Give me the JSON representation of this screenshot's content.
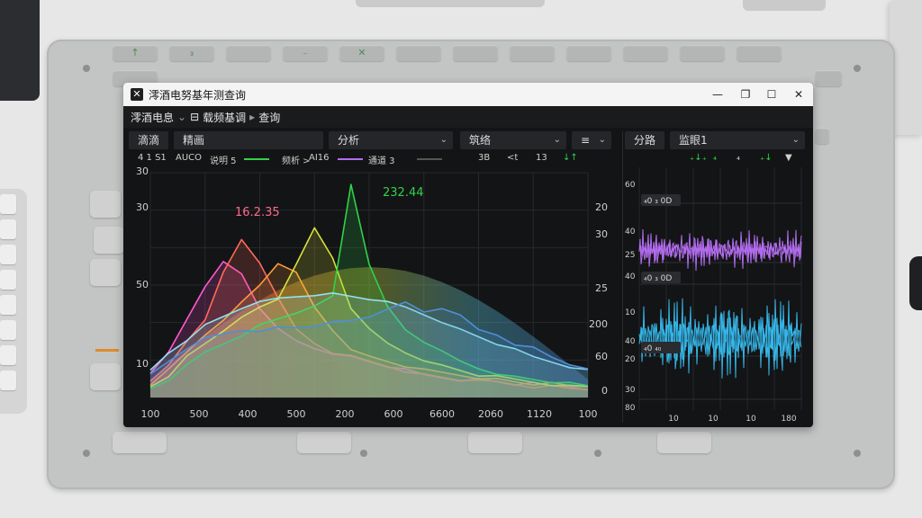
{
  "window": {
    "title": "澪酒电努基年测查询",
    "controls": {
      "minimize": "—",
      "maximize": "❐",
      "restore": "☐",
      "close": "✕"
    }
  },
  "menubar": {
    "item1": "澪酒电息",
    "chevron": "⌄",
    "icon": "⊟",
    "item2": "载频基调",
    "arrow": "▸",
    "item3": "查询"
  },
  "toolbar": {
    "box1": "滴滴",
    "box2": "精画",
    "box3": "分析",
    "box4": "筑络",
    "box5": "≡",
    "dropdown_arrow": "⌄",
    "right_box1": "分路",
    "right_box2": "监眼1",
    "icon": "⏆"
  },
  "legend": {
    "a": "4 1 S1",
    "b": "AUCO",
    "c": "说明 5",
    "d": "频析 >",
    "e": "AI16",
    "f": "通道 3",
    "g": "3B",
    "h": "<t",
    "i": "13",
    "j": "↓↑"
  },
  "right_legend": {
    "a": "₊↓₊",
    "b": "₄",
    "c": "₄",
    "d": "₊↓",
    "e": "▼"
  },
  "chart_data": {
    "type": "area",
    "x_ticks": [
      "100",
      "500",
      "400",
      "500",
      "200",
      "600",
      "6600",
      "2060",
      "1120",
      "100"
    ],
    "y_left_ticks": [
      "30",
      "30",
      "50",
      "10"
    ],
    "y_right_ticks": [
      "20",
      "30",
      "25",
      "200",
      "60",
      "0"
    ],
    "peak_labels": [
      "16.2.35",
      "232.44"
    ],
    "colors": {
      "pink": "#ff5ad0",
      "red": "#ff6a5a",
      "orange": "#ff9a3a",
      "yellow": "#d8e23a",
      "green": "#32d14a",
      "cyan": "#8fe3f0",
      "blue": "#4f8fd8",
      "purple": "#b46df0"
    },
    "series": [
      {
        "color": "pink",
        "values": [
          10,
          20,
          35,
          50,
          60,
          55,
          40,
          30,
          25,
          22,
          20,
          18,
          16,
          14,
          12,
          10,
          9,
          8,
          8,
          7,
          6,
          6,
          5,
          5,
          4
        ]
      },
      {
        "color": "red",
        "values": [
          8,
          14,
          25,
          35,
          55,
          70,
          60,
          45,
          30,
          24,
          20,
          18,
          16,
          14,
          12,
          10,
          9,
          8,
          7,
          7,
          6,
          5,
          5,
          4,
          4
        ]
      },
      {
        "color": "orange",
        "values": [
          6,
          12,
          20,
          28,
          35,
          42,
          50,
          60,
          55,
          40,
          30,
          22,
          18,
          16,
          14,
          12,
          11,
          10,
          9,
          8,
          7,
          6,
          6,
          5,
          5
        ]
      },
      {
        "color": "yellow",
        "values": [
          5,
          10,
          18,
          24,
          30,
          35,
          40,
          44,
          60,
          75,
          62,
          40,
          30,
          24,
          20,
          17,
          14,
          12,
          10,
          9,
          8,
          7,
          6,
          5,
          5
        ]
      },
      {
        "color": "green",
        "values": [
          4,
          8,
          14,
          20,
          24,
          28,
          32,
          35,
          38,
          40,
          45,
          95,
          60,
          40,
          30,
          25,
          20,
          16,
          13,
          11,
          9,
          8,
          7,
          6,
          5
        ]
      },
      {
        "color": "cyan",
        "values": [
          12,
          20,
          26,
          32,
          36,
          40,
          42,
          44,
          45,
          46,
          46,
          45,
          44,
          42,
          40,
          37,
          34,
          30,
          27,
          24,
          21,
          18,
          16,
          14,
          12
        ]
      },
      {
        "color": "blue",
        "values": [
          10,
          16,
          22,
          26,
          28,
          30,
          30,
          31,
          31,
          32,
          33,
          34,
          36,
          40,
          42,
          38,
          40,
          36,
          30,
          28,
          24,
          22,
          18,
          15,
          12
        ]
      }
    ],
    "xlabel": "",
    "ylabel": ""
  },
  "waveforms": {
    "y_labels": [
      "60",
      "40",
      "25",
      "40",
      "10",
      "40",
      "20",
      "30",
      "80"
    ],
    "x_labels": [
      "10",
      "10",
      "10",
      "180"
    ],
    "tags": [
      "₄0 ₃ 0D",
      "₄0 ₃ 0D",
      "₄0 ₄₀"
    ],
    "colors": {
      "purple": "#b46df0",
      "cyan": "#35b6e8"
    }
  },
  "tablet_keys": {
    "key1": "↑",
    "key2": "₃",
    "key3": "₋",
    "key4": "✕"
  }
}
